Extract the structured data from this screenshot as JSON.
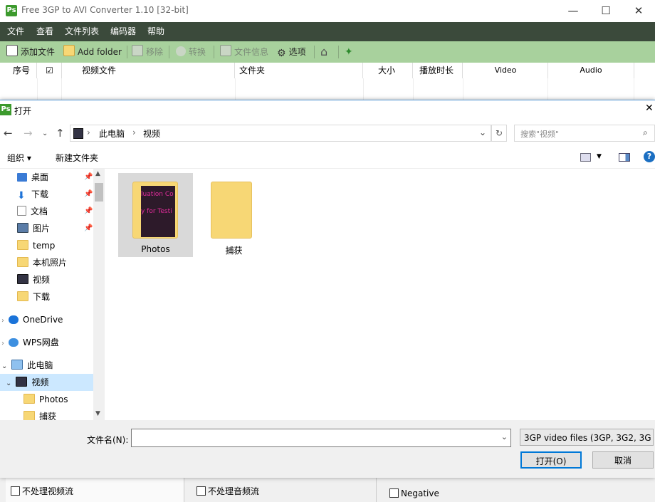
{
  "app": {
    "title": "Free 3GP to AVI Converter 1.10  [32-bit]",
    "icon_text": "Ps",
    "window_buttons": [
      "—",
      "☐",
      "✕"
    ],
    "menu": [
      "文件",
      "查看",
      "文件列表",
      "编码器",
      "帮助"
    ],
    "toolbar": [
      {
        "label": "添加文件",
        "enabled": true
      },
      {
        "label": "Add folder",
        "enabled": true
      },
      {
        "label": "移除",
        "enabled": false
      },
      {
        "label": "转换",
        "enabled": false
      },
      {
        "label": "文件信息",
        "enabled": false
      },
      {
        "label": "选项",
        "enabled": true
      }
    ],
    "columns": [
      "序号",
      "☑",
      "视频文件",
      "文件夹",
      "大小",
      "播放时长",
      "Video",
      "Audio"
    ],
    "bottom": {
      "chk_no_video": "不处理视频流",
      "chk_no_audio": "不处理音频流",
      "chk_negative": "Negative"
    }
  },
  "dialog": {
    "title": "打开",
    "close": "✕",
    "breadcrumb": [
      "此电脑",
      "视频"
    ],
    "search_placeholder": "搜索\"视频\"",
    "organize": "组织 ▾",
    "new_folder": "新建文件夹",
    "nav_items": [
      {
        "label": "桌面",
        "pinned": true
      },
      {
        "label": "下载",
        "pinned": true
      },
      {
        "label": "文档",
        "pinned": true
      },
      {
        "label": "图片",
        "pinned": true
      },
      {
        "label": "temp",
        "pinned": false
      },
      {
        "label": "本机照片",
        "pinned": false
      },
      {
        "label": "视频",
        "pinned": false
      },
      {
        "label": "下载",
        "pinned": false
      },
      {
        "label": "OneDrive",
        "pinned": false
      },
      {
        "label": "WPS网盘",
        "pinned": false
      },
      {
        "label": "此电脑",
        "pinned": false
      },
      {
        "label": "视频",
        "pinned": false
      },
      {
        "label": "Photos",
        "pinned": false
      },
      {
        "label": "捕获",
        "pinned": false
      }
    ],
    "items": [
      {
        "label": "Photos",
        "thumb_text": "luation Co y for Testi"
      },
      {
        "label": "捕获"
      }
    ],
    "file_name_label": "文件名(N):",
    "file_name_value": "",
    "filter": "3GP video files (3GP, 3G2, 3G",
    "open_button": "打开(O)",
    "cancel_button": "取消"
  },
  "colors": {
    "menubar": "#3b4a3b",
    "toolbar": "#a8d19d",
    "accent": "#0078d7"
  }
}
